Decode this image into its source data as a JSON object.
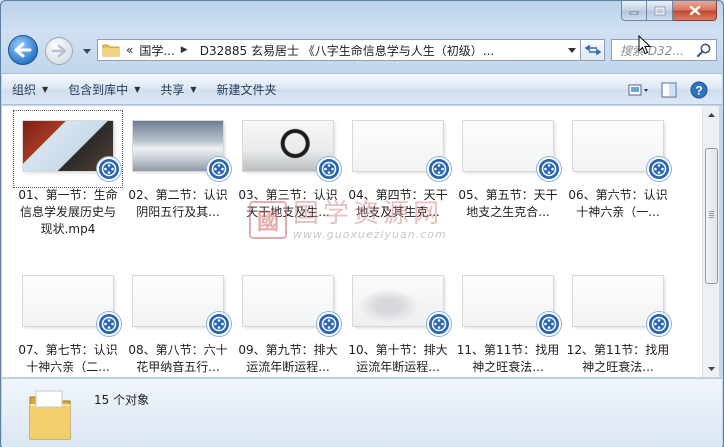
{
  "window": {
    "title": ""
  },
  "address": {
    "crumbs": [
      "«",
      "国学...",
      "D32885 玄易居士 《八字生命信息学与人生（初级）..."
    ]
  },
  "search": {
    "placeholder": "搜索 D32..."
  },
  "toolbar": {
    "organize": "组织",
    "include_library": "包含到库中",
    "share": "共享",
    "new_folder": "新建文件夹"
  },
  "files": [
    {
      "name": "01、第一节：生命信息学发展历史与现状.mp4",
      "thumb": "dark"
    },
    {
      "name": "02、第二节：认识阴阳五行及其...",
      "thumb": "sky"
    },
    {
      "name": "03、第三节：认识天干地支及生...",
      "thumb": "ring"
    },
    {
      "name": "04、第四节：天干地支及其生克...",
      "thumb": "blank"
    },
    {
      "name": "05、第五节：天干地支之生克合...",
      "thumb": "blank"
    },
    {
      "name": "06、第六节：认识十神六亲（一...",
      "thumb": "blank"
    },
    {
      "name": "07、第七节：认识十神六亲（二...",
      "thumb": "blank"
    },
    {
      "name": "08、第八节：六十花甲纳音五行...",
      "thumb": "blank"
    },
    {
      "name": "09、第九节：排大运流年断运程...",
      "thumb": "blank"
    },
    {
      "name": "10、第十节：排大运流年断运程...",
      "thumb": "cloud"
    },
    {
      "name": "11、第11节：找用神之旺衰法...",
      "thumb": "blank"
    },
    {
      "name": "12、第11节：找用神之旺衰法...",
      "thumb": "blank"
    }
  ],
  "watermark": {
    "cn": "国学资源网",
    "url": "www.guoxueziyuan.com",
    "seal": "國"
  },
  "details": {
    "count_text": "15 个对象"
  },
  "icons": [
    "back-arrow-icon",
    "forward-arrow-icon",
    "folder-icon",
    "refresh-icon",
    "search-icon",
    "view-icon",
    "preview-pane-icon",
    "help-icon",
    "video-badge-icon",
    "minimize-icon",
    "maximize-icon",
    "close-icon"
  ],
  "colors": {
    "accent": "#2a67b3",
    "window_frame": "#c3d7ec",
    "close_button": "#c5452c"
  }
}
